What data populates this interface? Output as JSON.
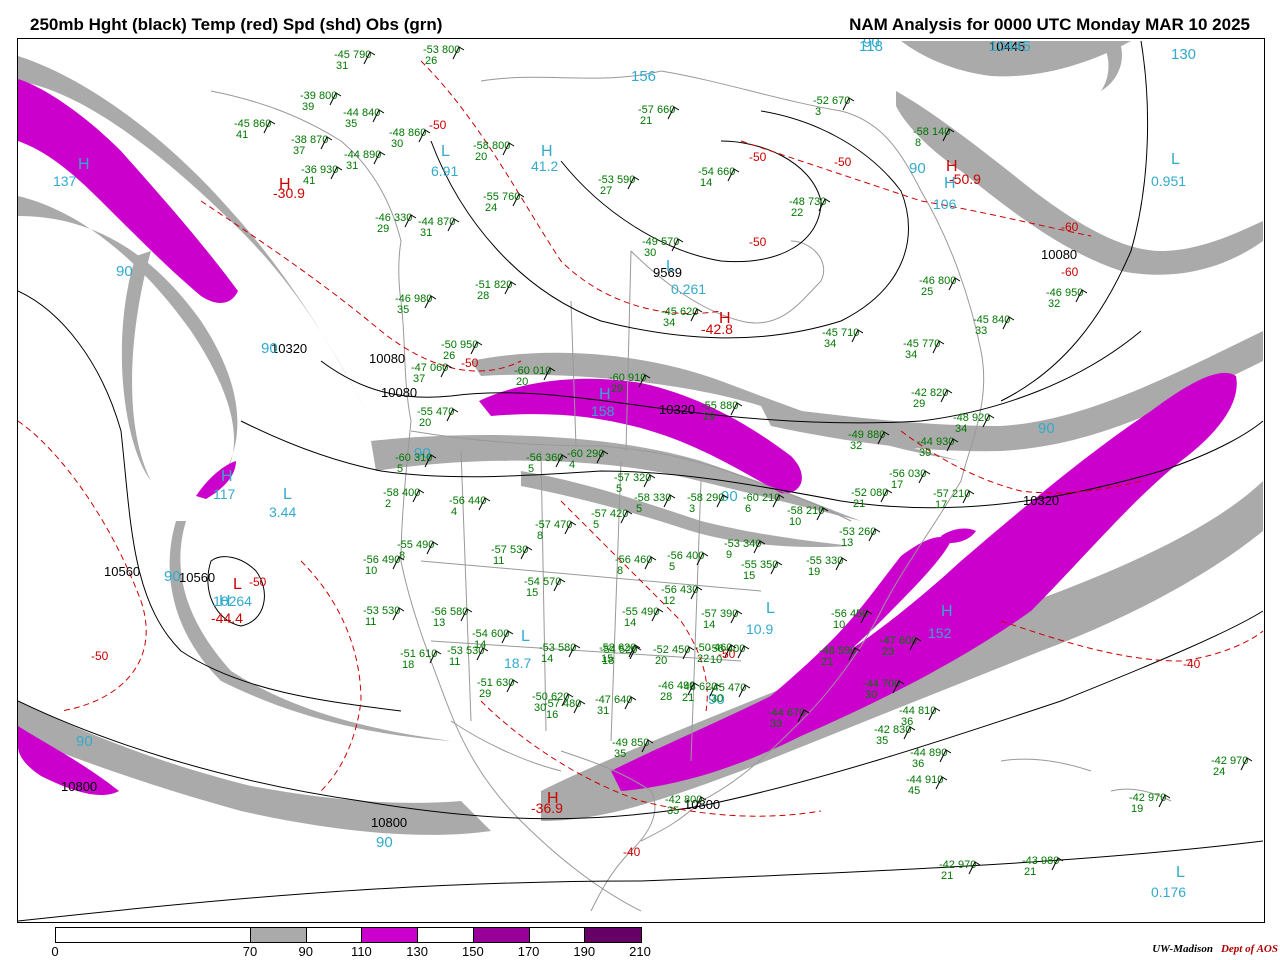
{
  "header": {
    "left_title": "250mb Hght (black) Temp (red) Spd (shd) Obs (grn)",
    "right_title": "NAM Analysis for 0000 UTC Monday  MAR 10 2025"
  },
  "colors": {
    "height_contour": "#000000",
    "temperature_contour": "#cc0000",
    "observations": "#007700",
    "extrema_labels": "#33aacc",
    "speed_70_90": "#aaaaaa",
    "speed_110_130": "#cc00cc",
    "speed_150_170": "#990099",
    "speed_190_210": "#660066",
    "geography": "#999999"
  },
  "legend": {
    "ticks": [
      "0",
      "70",
      "90",
      "110",
      "130",
      "150",
      "170",
      "190",
      "210"
    ],
    "segments": [
      {
        "from": 0,
        "to": 70,
        "color": "#ffffff"
      },
      {
        "from": 70,
        "to": 90,
        "color": "#aaaaaa"
      },
      {
        "from": 90,
        "to": 110,
        "color": "#ffffff"
      },
      {
        "from": 110,
        "to": 130,
        "color": "#cc00cc"
      },
      {
        "from": 130,
        "to": 150,
        "color": "#ffffff"
      },
      {
        "from": 150,
        "to": 170,
        "color": "#990099"
      },
      {
        "from": 170,
        "to": 190,
        "color": "#ffffff"
      },
      {
        "from": 190,
        "to": 210,
        "color": "#660066"
      }
    ]
  },
  "credit": {
    "org": "UW-Madison",
    "dept": "Dept of AOS"
  },
  "map_labels": {
    "height_contours": [
      "10320",
      "10080",
      "10320",
      "10560",
      "10800",
      "10800",
      "10080",
      "9569",
      "10560",
      "10080",
      "10320",
      "10800",
      "10445"
    ],
    "temperature_contours": [
      "-50",
      "-50",
      "-50",
      "-50",
      "-50",
      "-40",
      "-40",
      "-50",
      "-50",
      "-50",
      "-60",
      "-60"
    ],
    "extrema": [
      {
        "symbol": "H",
        "value": "137"
      },
      {
        "symbol": "H",
        "value": "-30.9"
      },
      {
        "symbol": "L",
        "value": "6.91"
      },
      {
        "symbol": "H",
        "value": "41.2"
      },
      {
        "symbol": "L",
        "value": "0.261"
      },
      {
        "symbol": "H",
        "value": "-42.8"
      },
      {
        "symbol": "L",
        "value": "0.951"
      },
      {
        "symbol": "H",
        "value": "106"
      },
      {
        "symbol": "H",
        "value": "-50.9"
      },
      {
        "symbol": "L",
        "value": "3.44"
      },
      {
        "symbol": "H",
        "value": "117"
      },
      {
        "symbol": "L",
        "value": "-44.4"
      },
      {
        "symbol": "H",
        "value": "10264"
      },
      {
        "symbol": "H",
        "value": "-36.9"
      },
      {
        "symbol": "L",
        "value": "18.7"
      },
      {
        "symbol": "L",
        "value": "10.9"
      },
      {
        "symbol": "H",
        "value": "152"
      },
      {
        "symbol": "L",
        "value": "0.176"
      },
      {
        "symbol": "H",
        "value": "158"
      }
    ],
    "speed_labels": [
      "90",
      "90",
      "90",
      "90",
      "90",
      "90",
      "90",
      "90",
      "90",
      "90",
      "90",
      "118",
      "130",
      "156",
      "10445"
    ],
    "observations": [
      {
        "t": "-45",
        "h": "790",
        "d": "31"
      },
      {
        "t": "-53",
        "h": "800",
        "d": "26"
      },
      {
        "t": "-39",
        "h": "800",
        "d": "39"
      },
      {
        "t": "-44",
        "h": "840",
        "d": "35"
      },
      {
        "t": "-48",
        "h": "860",
        "d": "30"
      },
      {
        "t": "-45",
        "h": "860",
        "d": "41"
      },
      {
        "t": "-38",
        "h": "870",
        "d": "37"
      },
      {
        "t": "-44",
        "h": "890",
        "d": "31"
      },
      {
        "t": "-36",
        "h": "930",
        "d": "41"
      },
      {
        "t": "-58",
        "h": "800",
        "d": "20"
      },
      {
        "t": "-55",
        "h": "760",
        "d": "24"
      },
      {
        "t": "-53",
        "h": "590",
        "d": "27"
      },
      {
        "t": "-57",
        "h": "660",
        "d": "21"
      },
      {
        "t": "-54",
        "h": "660",
        "d": "14"
      },
      {
        "t": "-52",
        "h": "670",
        "d": "3"
      },
      {
        "t": "-48",
        "h": "730",
        "d": "22"
      },
      {
        "t": "-58",
        "h": "140",
        "d": "8"
      },
      {
        "t": "-46",
        "h": "330",
        "d": "29"
      },
      {
        "t": "-44",
        "h": "870",
        "d": "31"
      },
      {
        "t": "-51",
        "h": "820",
        "d": "28"
      },
      {
        "t": "-49",
        "h": "570",
        "d": "30"
      },
      {
        "t": "-45",
        "h": "620",
        "d": "34"
      },
      {
        "t": "-46",
        "h": "800",
        "d": "25"
      },
      {
        "t": "-46",
        "h": "950",
        "d": "32"
      },
      {
        "t": "-45",
        "h": "710",
        "d": "34"
      },
      {
        "t": "-45",
        "h": "840",
        "d": "33"
      },
      {
        "t": "-45",
        "h": "770",
        "d": "34"
      },
      {
        "t": "-46",
        "h": "980",
        "d": "35"
      },
      {
        "t": "-50",
        "h": "950",
        "d": "26"
      },
      {
        "t": "-47",
        "h": "060",
        "d": "37"
      },
      {
        "t": "-55",
        "h": "470",
        "d": "20"
      },
      {
        "t": "-60",
        "h": "010",
        "d": "20"
      },
      {
        "t": "-60",
        "h": "910",
        "d": "29"
      },
      {
        "t": "-55",
        "h": "880",
        "d": "29"
      },
      {
        "t": "-42",
        "h": "820",
        "d": "29"
      },
      {
        "t": "-48",
        "h": "920",
        "d": "34"
      },
      {
        "t": "-49",
        "h": "880",
        "d": "32"
      },
      {
        "t": "-44",
        "h": "930",
        "d": "39"
      },
      {
        "t": "-60",
        "h": "310",
        "d": "5"
      },
      {
        "t": "-56",
        "h": "360",
        "d": "5"
      },
      {
        "t": "-60",
        "h": "290",
        "d": "4"
      },
      {
        "t": "-57",
        "h": "320",
        "d": "5"
      },
      {
        "t": "-58",
        "h": "330",
        "d": "5"
      },
      {
        "t": "-58",
        "h": "290",
        "d": "3"
      },
      {
        "t": "-60",
        "h": "210",
        "d": "6"
      },
      {
        "t": "-58",
        "h": "210",
        "d": "10"
      },
      {
        "t": "-56",
        "h": "030",
        "d": "17"
      },
      {
        "t": "-52",
        "h": "080",
        "d": "21"
      },
      {
        "t": "-57",
        "h": "210",
        "d": "17"
      },
      {
        "t": "-58",
        "h": "400",
        "d": "2"
      },
      {
        "t": "-56",
        "h": "440",
        "d": "4"
      },
      {
        "t": "-57",
        "h": "470",
        "d": "8"
      },
      {
        "t": "-57",
        "h": "420",
        "d": "5"
      },
      {
        "t": "-53",
        "h": "260",
        "d": "13"
      },
      {
        "t": "-55",
        "h": "490",
        "d": "8"
      },
      {
        "t": "-57",
        "h": "530",
        "d": "11"
      },
      {
        "t": "-56",
        "h": "460",
        "d": "8"
      },
      {
        "t": "-56",
        "h": "400",
        "d": "5"
      },
      {
        "t": "-53",
        "h": "340",
        "d": "9"
      },
      {
        "t": "-55",
        "h": "350",
        "d": "15"
      },
      {
        "t": "-55",
        "h": "330",
        "d": "19"
      },
      {
        "t": "-56",
        "h": "450",
        "d": "10"
      },
      {
        "t": "-56",
        "h": "400",
        "d": "10"
      },
      {
        "t": "-54",
        "h": "570",
        "d": "15"
      },
      {
        "t": "-56",
        "h": "430",
        "d": "12"
      },
      {
        "t": "-57",
        "h": "390",
        "d": "14"
      },
      {
        "t": "-55",
        "h": "490",
        "d": "14"
      },
      {
        "t": "-53",
        "h": "530",
        "d": "11"
      },
      {
        "t": "-56",
        "h": "580",
        "d": "13"
      },
      {
        "t": "-54",
        "h": "600",
        "d": "14"
      },
      {
        "t": "-53",
        "h": "580",
        "d": "14"
      },
      {
        "t": "-54",
        "h": "520",
        "d": "18"
      },
      {
        "t": "-52",
        "h": "450",
        "d": "20"
      },
      {
        "t": "-50",
        "h": "460",
        "d": "22"
      },
      {
        "t": "-48",
        "h": "620",
        "d": "21"
      },
      {
        "t": "-51",
        "h": "610",
        "d": "18"
      },
      {
        "t": "-51",
        "h": "630",
        "d": "29"
      },
      {
        "t": "-50",
        "h": "620",
        "d": "30"
      },
      {
        "t": "-47",
        "h": "640",
        "d": "31"
      },
      {
        "t": "-46",
        "h": "490",
        "d": "28"
      },
      {
        "t": "-45",
        "h": "470",
        "d": "30"
      },
      {
        "t": "-44",
        "h": "670",
        "d": "33"
      },
      {
        "t": "-48",
        "h": "590",
        "d": "21"
      },
      {
        "t": "-47",
        "h": "600",
        "d": "23"
      },
      {
        "t": "-44",
        "h": "700",
        "d": "30"
      },
      {
        "t": "-44",
        "h": "810",
        "d": "36"
      },
      {
        "t": "-42",
        "h": "830",
        "d": "35"
      },
      {
        "t": "-44",
        "h": "890",
        "d": "36"
      },
      {
        "t": "-44",
        "h": "910",
        "d": "45"
      },
      {
        "t": "-42",
        "h": "970",
        "d": "24"
      },
      {
        "t": "-42",
        "h": "970",
        "d": "19"
      },
      {
        "t": "-43",
        "h": "980",
        "d": "21"
      },
      {
        "t": "-42",
        "h": "970",
        "d": "21"
      },
      {
        "t": "-49",
        "h": "850",
        "d": "35"
      },
      {
        "t": "-42",
        "h": "800",
        "d": "35"
      },
      {
        "t": "-56",
        "h": "490",
        "d": "10"
      },
      {
        "t": "-58",
        "h": "620",
        "d": "15"
      },
      {
        "t": "-53",
        "h": "530",
        "d": "11"
      },
      {
        "t": "-57",
        "h": "480",
        "d": "16"
      }
    ]
  }
}
